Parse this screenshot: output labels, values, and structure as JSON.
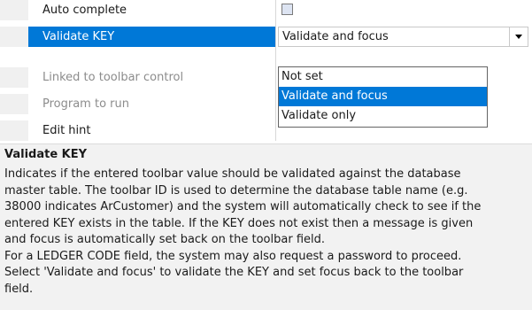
{
  "properties": [
    {
      "label": "Auto complete",
      "state": "enabled"
    },
    {
      "label": "Validate KEY",
      "state": "selected"
    },
    {
      "label": "Linked to toolbar control",
      "state": "disabled"
    },
    {
      "label": "Program to run",
      "state": "disabled"
    },
    {
      "label": "Edit hint",
      "state": "enabled"
    }
  ],
  "validate_key_combo": {
    "value": "Validate and focus",
    "options": [
      "Not set",
      "Validate and focus",
      "Validate only"
    ],
    "highlighted": "Validate and focus"
  },
  "description": {
    "title": "Validate KEY",
    "lines": [
      "Indicates if the entered toolbar value should be validated against the database",
      "master table. The toolbar ID is used to determine the database table name (e.g.",
      "38000 indicates ArCustomer) and the system will automatically check to see if the",
      "entered KEY exists in the table. If the KEY does not exist then a message is given",
      "and focus is automatically set back on the toolbar field.",
      "For a LEDGER CODE field, the system may also request a password to proceed.",
      "Select 'Validate and focus' to validate the KEY and set focus back to the toolbar",
      "field."
    ]
  },
  "colors": {
    "selection": "#0078d7",
    "disabled_text": "#8c8c8c",
    "description_bg": "#f2f2f2"
  }
}
